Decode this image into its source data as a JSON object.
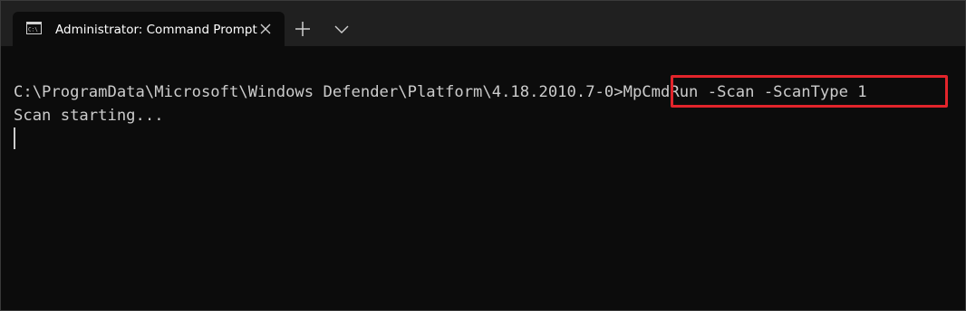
{
  "window": {
    "tab_title": "Administrator: Command Prompt",
    "tab_icon": "cmd-icon",
    "close_icon": "close-icon",
    "new_tab_icon": "plus-icon",
    "dropdown_icon": "chevron-down-icon"
  },
  "terminal": {
    "prompt": "C:\\ProgramData\\Microsoft\\Windows Defender\\Platform\\4.18.2010.7-0>",
    "command": "MpCmdRun -Scan -ScanType 1",
    "output": "Scan starting..."
  },
  "colors": {
    "background": "#0c0c0c",
    "tabstrip": "#202020",
    "text": "#cccccc",
    "highlight": "#e2242b"
  }
}
